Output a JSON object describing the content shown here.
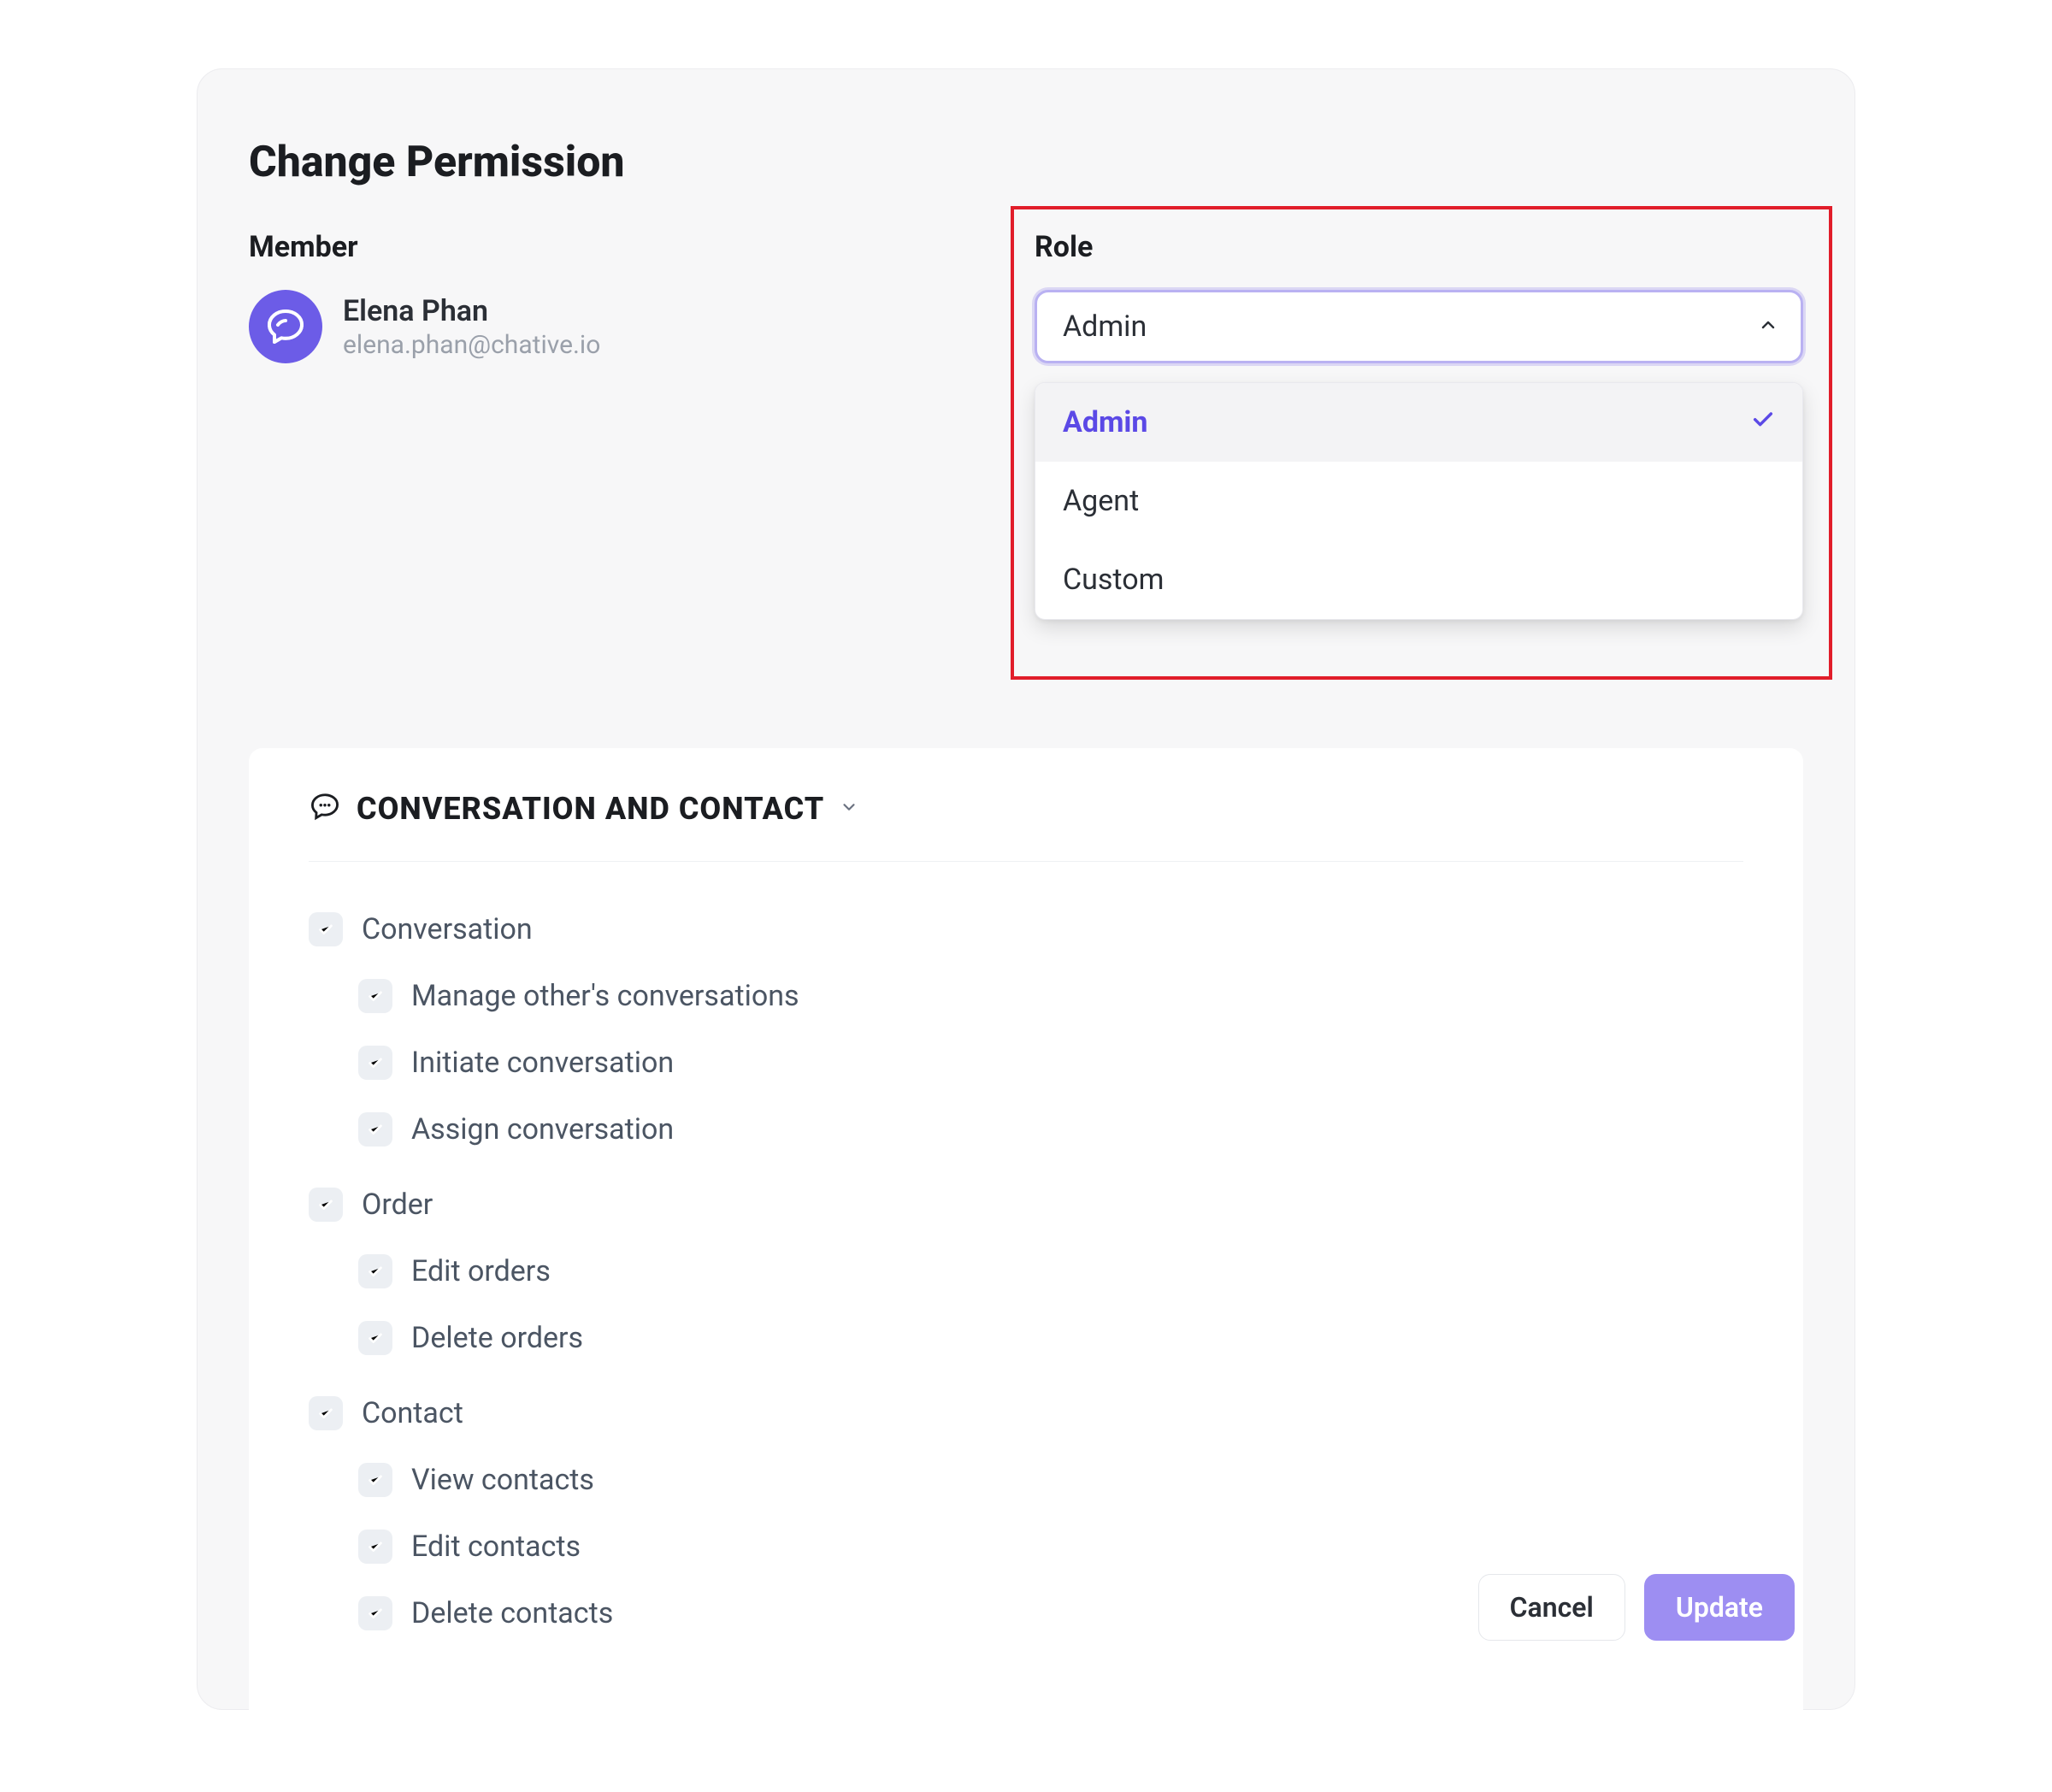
{
  "page": {
    "title": "Change Permission"
  },
  "member": {
    "label": "Member",
    "name": "Elena Phan",
    "email": "elena.phan@chative.io"
  },
  "role": {
    "label": "Role",
    "selected": "Admin",
    "options": [
      "Admin",
      "Agent",
      "Custom"
    ]
  },
  "permissions": {
    "section_title": "CONVERSATION AND CONTACT",
    "groups": [
      {
        "label": "Conversation",
        "children": [
          "Manage other's conversations",
          "Initiate conversation",
          "Assign conversation"
        ]
      },
      {
        "label": "Order",
        "children": [
          "Edit orders",
          "Delete orders"
        ]
      },
      {
        "label": "Contact",
        "children": [
          "View contacts",
          "Edit contacts",
          "Delete contacts"
        ]
      }
    ]
  },
  "footer": {
    "cancel": "Cancel",
    "update": "Update"
  },
  "colors": {
    "accent": "#6c5ce7",
    "highlight_border": "#e11d2a"
  }
}
